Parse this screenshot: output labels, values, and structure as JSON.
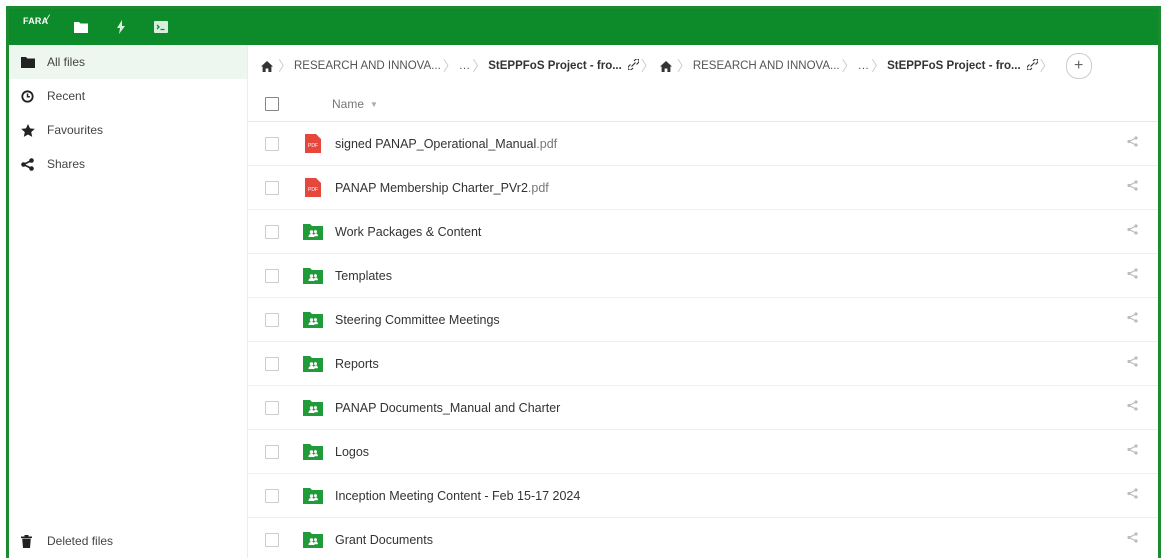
{
  "topbar": {
    "logo_text": "FARA",
    "icons": [
      "files-icon",
      "activity-icon",
      "terminal-icon"
    ],
    "brand_color": "#0d8a2a"
  },
  "sidebar": {
    "items": [
      {
        "label": "All files",
        "icon": "folder-icon",
        "active": true
      },
      {
        "label": "Recent",
        "icon": "clock-icon"
      },
      {
        "label": "Favourites",
        "icon": "star-icon"
      },
      {
        "label": "Shares",
        "icon": "share-icon"
      }
    ],
    "bottom": {
      "label": "Deleted files",
      "icon": "trash-icon"
    }
  },
  "breadcrumb": {
    "segments": [
      {
        "label": "RESEARCH AND INNOVA..."
      },
      {
        "label": "…"
      },
      {
        "label": "StEPPFoS Project - fro...",
        "bold": true
      },
      {
        "label": "RESEARCH AND INNOVA..."
      },
      {
        "label": "…"
      },
      {
        "label": "StEPPFoS Project - fro...",
        "bold": true
      }
    ],
    "add_label": "+"
  },
  "table": {
    "header_name": "Name",
    "rows": [
      {
        "name": "signed PANAP_Operational_Manual",
        "ext": ".pdf",
        "type": "pdf"
      },
      {
        "name": "PANAP Membership Charter_PVr2",
        "ext": ".pdf",
        "type": "pdf"
      },
      {
        "name": "Work Packages & Content",
        "ext": "",
        "type": "shared-folder"
      },
      {
        "name": "Templates",
        "ext": "",
        "type": "shared-folder"
      },
      {
        "name": "Steering Committee Meetings",
        "ext": "",
        "type": "shared-folder"
      },
      {
        "name": "Reports",
        "ext": "",
        "type": "shared-folder"
      },
      {
        "name": "PANAP Documents_Manual and Charter",
        "ext": "",
        "type": "shared-folder"
      },
      {
        "name": "Logos",
        "ext": "",
        "type": "shared-folder"
      },
      {
        "name": "Inception Meeting Content - Feb 15-17 2024",
        "ext": "",
        "type": "shared-folder"
      },
      {
        "name": "Grant Documents",
        "ext": "",
        "type": "shared-folder"
      }
    ]
  },
  "colors": {
    "folder": "#1f9b3a",
    "pdf": "#e5473d"
  }
}
